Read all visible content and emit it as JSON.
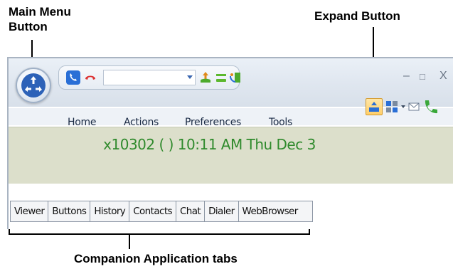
{
  "annotations": {
    "main_menu_button": "Main Menu Button",
    "expand_button": "Expand Button",
    "companion_tabs": "Companion Application tabs"
  },
  "window": {
    "controls": {
      "minimize": "–",
      "maximize": "□",
      "close": "X"
    }
  },
  "menu": {
    "items": [
      "Home",
      "Actions",
      "Preferences",
      "Tools"
    ]
  },
  "status": {
    "text": "x10302 ( ) 10:11 AM Thu Dec 3",
    "color": "#2f8a2c"
  },
  "tabs": [
    "Viewer",
    "Buttons",
    "History",
    "Contacts",
    "Chat",
    "Dialer",
    "WebBrowser"
  ],
  "colors": {
    "status_bg": "#dcdfcb",
    "accent_blue": "#2a6fd6",
    "hangup_red": "#d33",
    "expand_highlight": "#ffcf6a"
  }
}
